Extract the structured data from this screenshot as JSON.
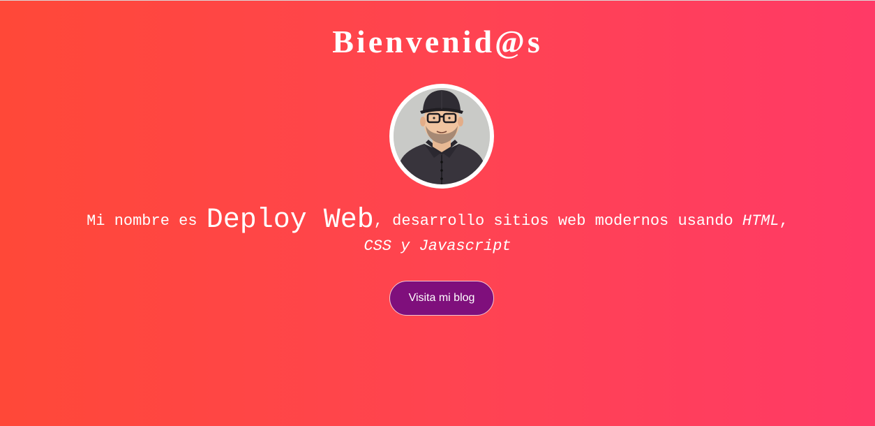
{
  "page": {
    "title": "Bienvenid@s"
  },
  "profile": {
    "avatar_icon": "developer-avatar-icon"
  },
  "intro": {
    "prefix": "Mi nombre es ",
    "name": "Deploy Web",
    "middle": ", desarrollo sitios web modernos usando ",
    "tech_1": "HTML",
    "separator": ", ",
    "tech_2": "CSS y Javascript"
  },
  "cta": {
    "label": "Visita mi blog"
  },
  "colors": {
    "background_start": "#ff4838",
    "background_end": "#ff3a66",
    "button": "#7f0f7c",
    "text": "#ffffff"
  }
}
